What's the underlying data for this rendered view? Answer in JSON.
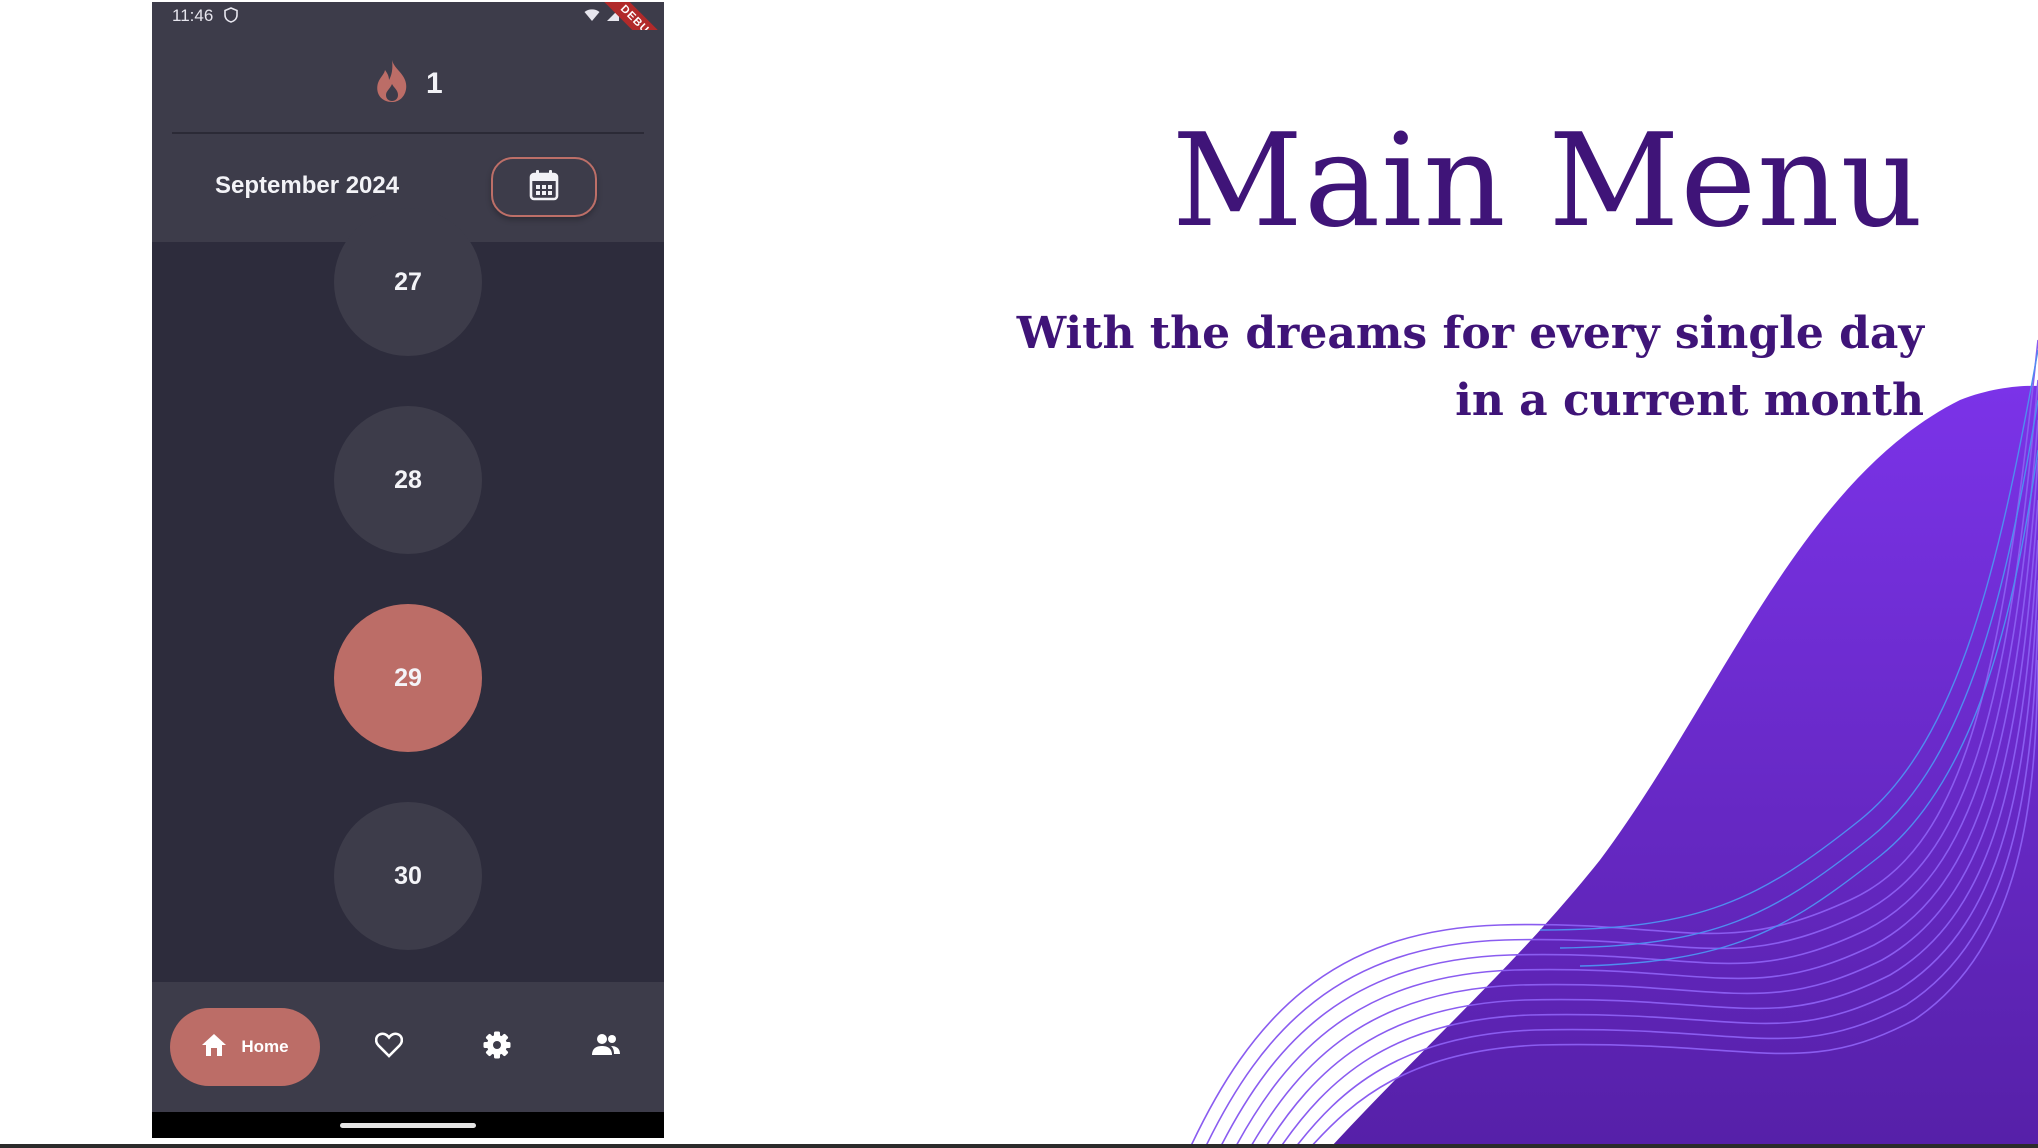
{
  "slide": {
    "title": "Main Menu",
    "subtitle": "With the dreams for every single day in a current month",
    "colors": {
      "text": "#3f1478",
      "wave_light": "#7b33e8",
      "wave_dark": "#5620a8",
      "wave_lines": "#8a5cf0"
    }
  },
  "phone": {
    "status_bar": {
      "time": "11:46",
      "debug_label": "DEBUG",
      "icons": [
        "shield-icon",
        "wifi-icon",
        "signal-icon",
        "battery-icon"
      ]
    },
    "header": {
      "streak_icon": "flame-icon",
      "streak_count": "1",
      "month_label": "September 2024",
      "calendar_button_icon": "calendar-icon"
    },
    "days": [
      {
        "label": "27",
        "selected": false
      },
      {
        "label": "28",
        "selected": false
      },
      {
        "label": "29",
        "selected": true
      },
      {
        "label": "30",
        "selected": false
      }
    ],
    "bottom_nav": {
      "items": [
        {
          "label": "Home",
          "icon": "home-icon",
          "active": true
        },
        {
          "label": "",
          "icon": "heart-icon",
          "active": false
        },
        {
          "label": "",
          "icon": "gear-icon",
          "active": false
        },
        {
          "label": "",
          "icon": "people-icon",
          "active": false
        }
      ]
    },
    "colors": {
      "background": "#2d2c3c",
      "surface": "#3d3c4a",
      "accent": "#bc6d67"
    }
  }
}
